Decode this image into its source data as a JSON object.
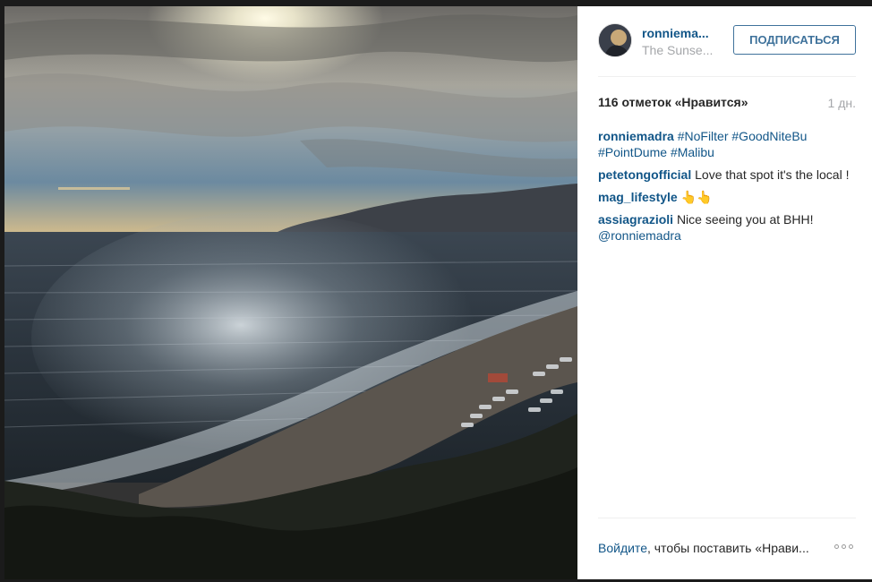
{
  "post": {
    "username": "ronniema...",
    "location": "The Sunse...",
    "follow_label": "ПОДПИСАТЬСЯ",
    "likes": "116 отметок «Нравится»",
    "time_ago": "1 дн.",
    "caption": {
      "user": "ronniemadra",
      "hashtags": [
        "#NoFilter",
        "#GoodNiteBu",
        "#PointDume",
        "#Malibu"
      ]
    },
    "comments": [
      {
        "user": "petetongofficial",
        "text": "Love that spot it's the local !"
      },
      {
        "user": "mag_lifestyle",
        "text": "👆👆"
      },
      {
        "user": "assiagrazioli",
        "text": "Nice seeing you at BHH!",
        "mention": "@ronniemadra"
      }
    ],
    "login_link": "Войдите",
    "login_text": ", чтобы поставить «Нрави..."
  },
  "colors": {
    "link_blue": "#125688",
    "follow_border": "#3f729b",
    "muted_gray": "#a5a7aa"
  },
  "icons": [
    "more-options-icon"
  ]
}
